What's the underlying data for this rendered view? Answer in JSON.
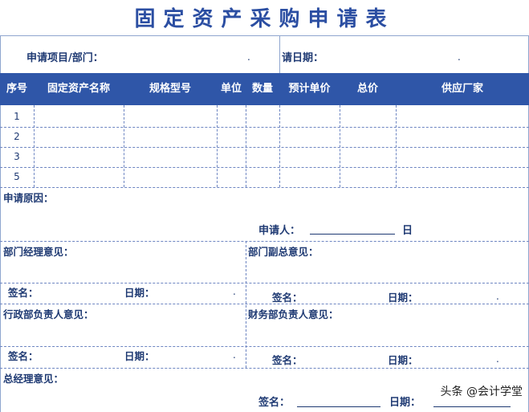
{
  "title": "固定资产采购申请表",
  "info": {
    "project_label": "申请项目/部门：",
    "project_value": ".",
    "date_label": "请日期：",
    "date_value": "."
  },
  "table": {
    "headers": [
      "序号",
      "固定资产名称",
      "规格型号",
      "单位",
      "数量",
      "预计单价",
      "总价",
      "供应厂家"
    ],
    "rows": [
      {
        "no": "1"
      },
      {
        "no": "2"
      },
      {
        "no": "3"
      },
      {
        "no": "5"
      }
    ]
  },
  "reason": {
    "label": "申请原因：",
    "applicant_label": "申请人：",
    "day_label": "日"
  },
  "opinions": {
    "dept_manager": "部门经理意见：",
    "dept_vp": "部门副总意见：",
    "admin_head": "行政部负责人意见：",
    "finance_head": "财务部负责人意见：",
    "general_manager": "总经理意见："
  },
  "sign": {
    "sign_label": "签名：",
    "date_label": "日期：",
    "dot": ".",
    "final_sign_label": "签名：",
    "final_date_label": "日期："
  },
  "watermark": "头条 @会计学堂",
  "colors": {
    "header_bg": "#2f56a8",
    "text": "#1f3a73",
    "title": "#2b4ea2"
  }
}
